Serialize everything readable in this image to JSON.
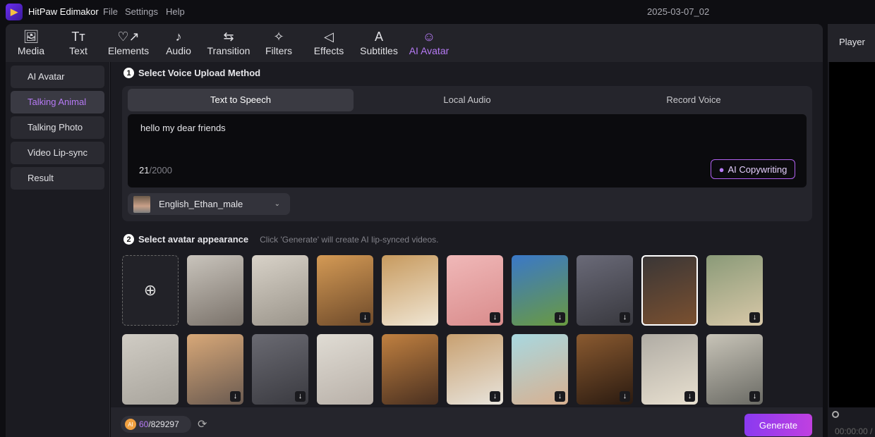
{
  "app": {
    "title": "HitPaw Edimakor",
    "menu": [
      "File",
      "Settings",
      "Help"
    ],
    "project": "2025-03-07_02"
  },
  "toolbar": [
    {
      "label": "Media",
      "icon": "media-icon",
      "glyph": "🖼"
    },
    {
      "label": "Text",
      "icon": "text-icon",
      "glyph": "Tт"
    },
    {
      "label": "Elements",
      "icon": "elements-icon",
      "glyph": "♡↗"
    },
    {
      "label": "Audio",
      "icon": "music-note-icon",
      "glyph": "♪"
    },
    {
      "label": "Transition",
      "icon": "transition-icon",
      "glyph": "⇆"
    },
    {
      "label": "Filters",
      "icon": "sparkle-icon",
      "glyph": "✧"
    },
    {
      "label": "Effects",
      "icon": "effects-icon",
      "glyph": "◁"
    },
    {
      "label": "Subtitles",
      "icon": "subtitles-icon",
      "glyph": "A"
    },
    {
      "label": "AI Avatar",
      "icon": "avatar-icon",
      "glyph": "☺",
      "active": true
    }
  ],
  "accent": "#b67af5",
  "sidebar": [
    {
      "label": "AI Avatar"
    },
    {
      "label": "Talking Animal",
      "active": true
    },
    {
      "label": "Talking Photo"
    },
    {
      "label": "Video Lip-sync"
    },
    {
      "label": "Result"
    }
  ],
  "step1": {
    "num": "1",
    "title": "Select Voice Upload Method",
    "tabs": [
      "Text to Speech",
      "Local Audio",
      "Record Voice"
    ],
    "text": "hello my dear friends",
    "count": "21",
    "max": "/2000",
    "copy": "AI Copywriting",
    "voice": "English_Ethan_male"
  },
  "step2": {
    "num": "2",
    "title": "Select avatar appearance",
    "hint": "Click 'Generate' will create AI lip-synced videos."
  },
  "avatars": [
    [
      {
        "c": "#c9c4bc,#7a726a",
        "dl": false
      },
      {
        "c": "#d8d2c8,#9a948a",
        "dl": false
      },
      {
        "c": "#d49a55,#6e4a2a",
        "dl": true
      },
      {
        "c": "#c79a5e,#f0e6d4",
        "dl": false
      },
      {
        "c": "#f0b8b8,#d98c8c",
        "dl": true
      },
      {
        "c": "#3a78c8,#6a9a40",
        "dl": true
      },
      {
        "c": "#6a6a78,#38383e",
        "dl": true
      },
      {
        "c": "#3a3636,#7a5030",
        "dl": false,
        "sel": true
      },
      {
        "c": "#8a9a78,#d8c8a8",
        "dl": true
      }
    ],
    [
      {
        "c": "#d0ccc4,#a8a49c",
        "dl": false
      },
      {
        "c": "#d8a878,#6a5a50",
        "dl": true
      },
      {
        "c": "#6a6a72,#3a3a40",
        "dl": true
      },
      {
        "c": "#e0dcd4,#b8b0a8",
        "dl": false
      },
      {
        "c": "#c08040,#4a3020",
        "dl": false
      },
      {
        "c": "#c8a070,#e8e4dc",
        "dl": true
      },
      {
        "c": "#a8d8e0,#d8b090",
        "dl": true
      },
      {
        "c": "#8a5a30,#2a1a10",
        "dl": true
      },
      {
        "c": "#b0aca4,#e8e0d0",
        "dl": true
      },
      {
        "c": "#c8c4b8,#6a6a64",
        "dl": true
      }
    ]
  ],
  "bottom": {
    "used": "60",
    "total": "/829297",
    "generate": "Generate"
  },
  "player": {
    "title": "Player",
    "time": "00:00:00 /"
  }
}
